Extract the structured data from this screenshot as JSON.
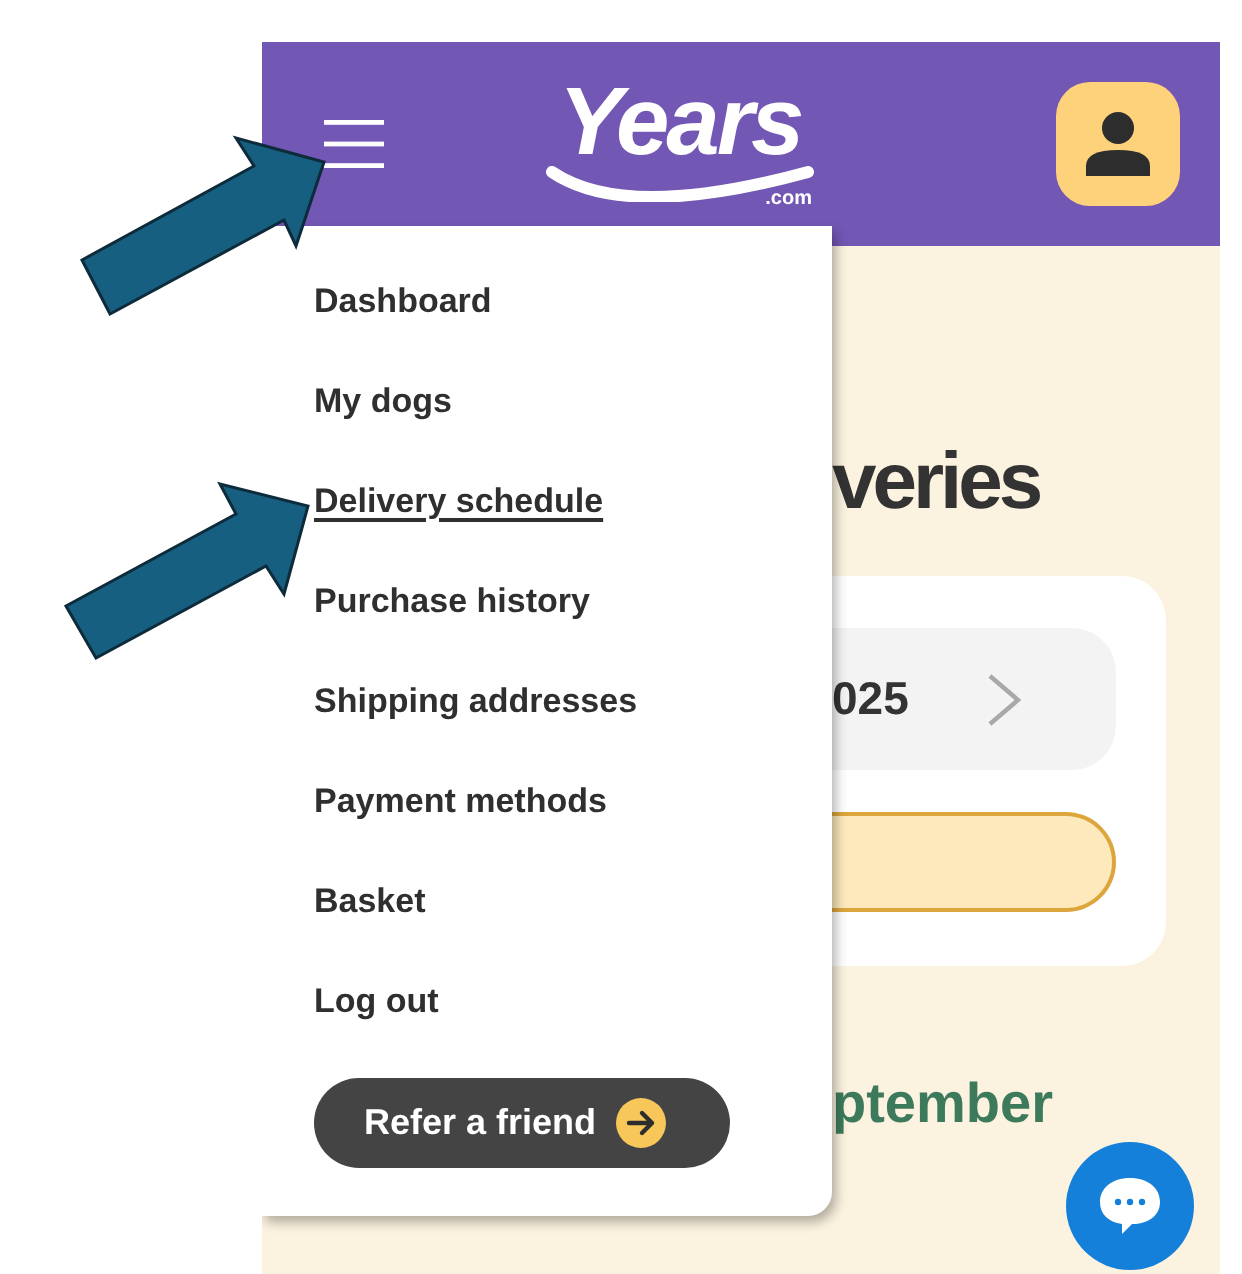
{
  "header": {
    "logo": {
      "name": "Years",
      "domain": ".com"
    }
  },
  "menu": {
    "items": [
      {
        "label": "Dashboard",
        "selected": false
      },
      {
        "label": "My dogs",
        "selected": false
      },
      {
        "label": "Delivery schedule",
        "selected": true
      },
      {
        "label": "Purchase history",
        "selected": false
      },
      {
        "label": "Shipping addresses",
        "selected": false
      },
      {
        "label": "Payment methods",
        "selected": false
      },
      {
        "label": "Basket",
        "selected": false
      },
      {
        "label": "Log out",
        "selected": false
      }
    ],
    "refer_button": {
      "label": "Refer a friend"
    }
  },
  "page": {
    "heading": "veries",
    "month_selector": {
      "label": "025"
    },
    "section_heading": "ptember"
  }
}
